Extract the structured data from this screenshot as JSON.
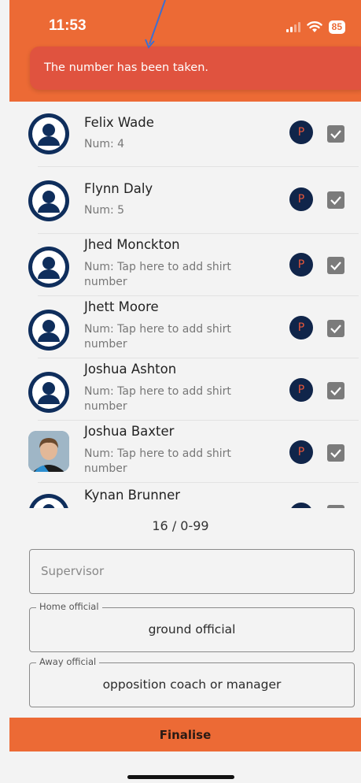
{
  "status_bar": {
    "time": "11:53",
    "battery": "85"
  },
  "toast": {
    "message": "The number has been taken."
  },
  "players": [
    {
      "name": "Felix Wade",
      "num": "Num: 4",
      "badge": "P",
      "checked": true
    },
    {
      "name": "Flynn Daly",
      "num": "Num: 5",
      "badge": "P",
      "checked": true
    },
    {
      "name": "Jhed Monckton",
      "num": "Num: Tap here to add shirt number",
      "badge": "P",
      "checked": true
    },
    {
      "name": "Jhett Moore",
      "num": "Num: Tap here to add shirt number",
      "badge": "P",
      "checked": true
    },
    {
      "name": "Joshua Ashton",
      "num": "Num: Tap here to add shirt number",
      "badge": "P",
      "checked": true
    },
    {
      "name": "Joshua Baxter",
      "num": "Num: Tap here to add shirt number",
      "badge": "P",
      "checked": true
    },
    {
      "name": "Kynan Brunner",
      "num": "",
      "badge": "P",
      "checked": true
    }
  ],
  "count": "16 / 0-99",
  "supervisor": {
    "placeholder": "Supervisor"
  },
  "home_official": {
    "legend": "Home official",
    "value": "ground official"
  },
  "away_official": {
    "legend": "Away official",
    "value": "opposition coach or manager"
  },
  "finalise_label": "Finalise",
  "colors": {
    "accent": "#ec6a35",
    "toast": "#e0533f",
    "navy": "#10254a"
  }
}
